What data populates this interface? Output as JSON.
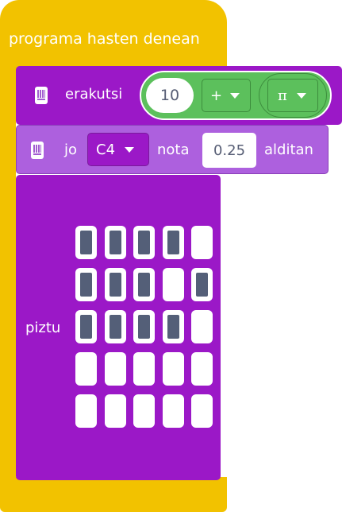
{
  "hat": {
    "label": "programa hasten denean"
  },
  "digit_block": {
    "label": "erakutsi",
    "number": "10",
    "operator": "+",
    "constant": "π"
  },
  "tone_block": {
    "prefix": "jo",
    "note": "C4",
    "middle": "nota",
    "duration": "0.25",
    "suffix": "alditan"
  },
  "leds_block": {
    "label": "piztu",
    "grid": [
      [
        1,
        1,
        1,
        1,
        0
      ],
      [
        1,
        1,
        1,
        0,
        1
      ],
      [
        1,
        1,
        1,
        1,
        0
      ],
      [
        0,
        0,
        0,
        0,
        0
      ],
      [
        0,
        0,
        0,
        0,
        0
      ]
    ]
  },
  "colors": {
    "event_yellow": "#f2c200",
    "microbit_purple": "#9b18c7",
    "music_purple": "#ad60de",
    "math_green": "#5cc05c",
    "led_on": "#545f78"
  }
}
